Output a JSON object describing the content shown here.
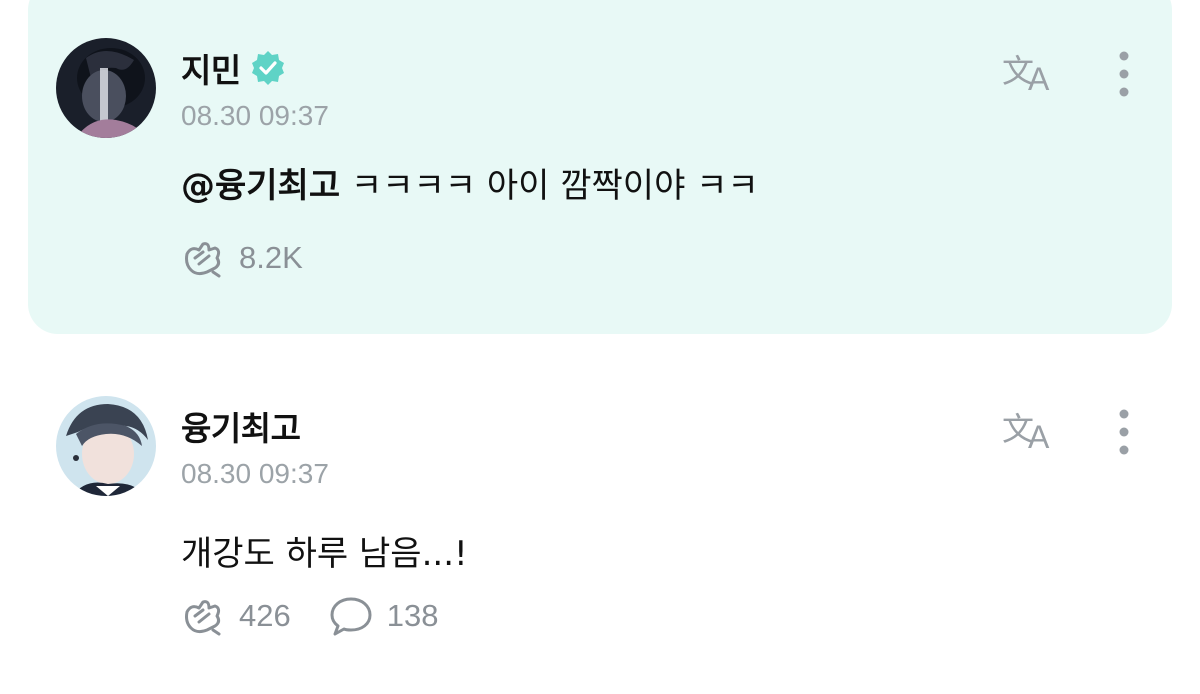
{
  "posts": [
    {
      "author": "지민",
      "verified": true,
      "timestamp": "08.30 09:37",
      "mention": "@융기최고",
      "text": " ㅋㅋㅋㅋ 아이 깜짝이야 ㅋㅋ",
      "likes": "8.2K",
      "highlighted": true
    },
    {
      "author": "융기최고",
      "verified": false,
      "timestamp": "08.30 09:37",
      "text": "개강도 하루 남음...!",
      "likes": "426",
      "comments": "138",
      "highlighted": false
    }
  ],
  "icons": {
    "translate": "translate-icon",
    "more": "more-vertical-icon",
    "like": "applause-icon",
    "comment": "comment-bubble-icon",
    "verified": "verified-badge-icon"
  },
  "colors": {
    "highlight_bg": "#e8f9f6",
    "verified": "#5fd3c6",
    "muted": "#9ca3a8"
  }
}
